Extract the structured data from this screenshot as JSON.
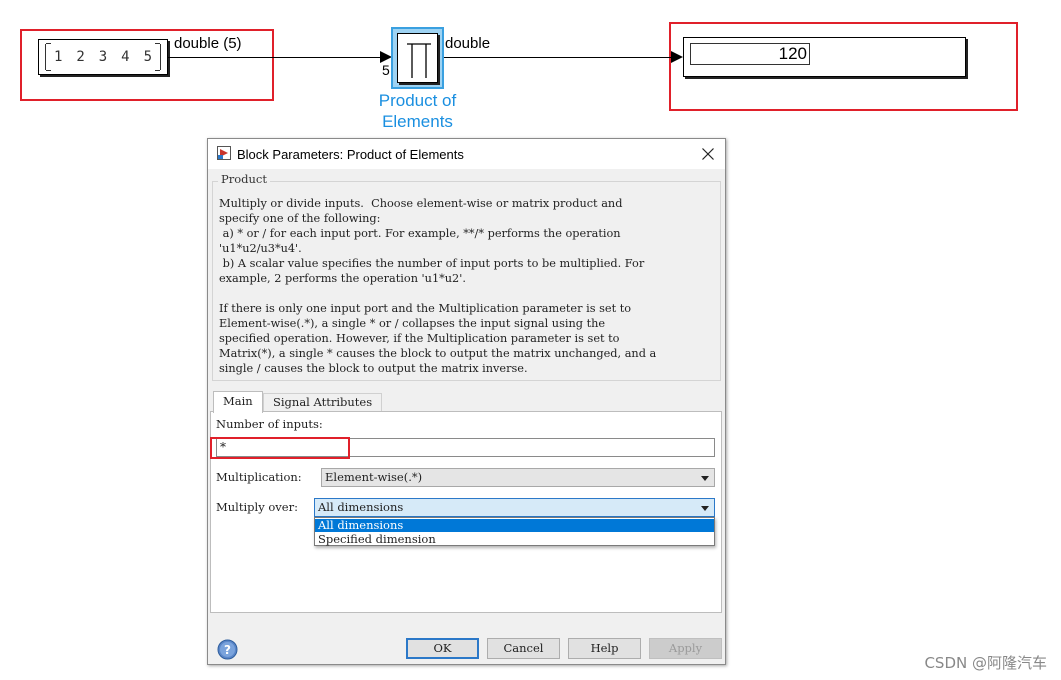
{
  "model": {
    "constant": {
      "values": [
        "1",
        "2",
        "3",
        "4",
        "5"
      ]
    },
    "signal_in_label": "double (5)",
    "signal_out_label": "double",
    "product_block": {
      "name_line1": "Product of",
      "name_line2": "Elements",
      "input_port_label": "5"
    },
    "display": {
      "value": "120"
    }
  },
  "dialog": {
    "title": "Block Parameters: Product of Elements",
    "group_title": "Product",
    "description": "Multiply or divide inputs.  Choose element-wise or matrix product and\nspecify one of the following:\n a) * or / for each input port. For example, **/* performs the operation\n'u1*u2/u3*u4'.\n b) A scalar value specifies the number of input ports to be multiplied. For\nexample, 2 performs the operation 'u1*u2'.\n\nIf there is only one input port and the Multiplication parameter is set to\nElement-wise(.*), a single * or / collapses the input signal using the\nspecified operation. However, if the Multiplication parameter is set to\nMatrix(*), a single * causes the block to output the matrix unchanged, and a\nsingle / causes the block to output the matrix inverse.",
    "tabs": [
      {
        "label": "Main"
      },
      {
        "label": "Signal Attributes"
      }
    ],
    "number_of_inputs": {
      "label": "Number of inputs:",
      "value": "*"
    },
    "multiplication": {
      "label": "Multiplication:",
      "value": "Element-wise(.*)"
    },
    "multiply_over": {
      "label": "Multiply over:",
      "value": "All dimensions",
      "options": [
        "All dimensions",
        "Specified dimension"
      ]
    },
    "buttons": {
      "ok": "OK",
      "cancel": "Cancel",
      "help": "Help",
      "apply": "Apply"
    }
  },
  "watermark": "CSDN @阿隆汽车",
  "colors": {
    "highlight_red": "#e0202a",
    "block_blue": "#1a8fe0",
    "selection_blue": "#0078d7"
  }
}
